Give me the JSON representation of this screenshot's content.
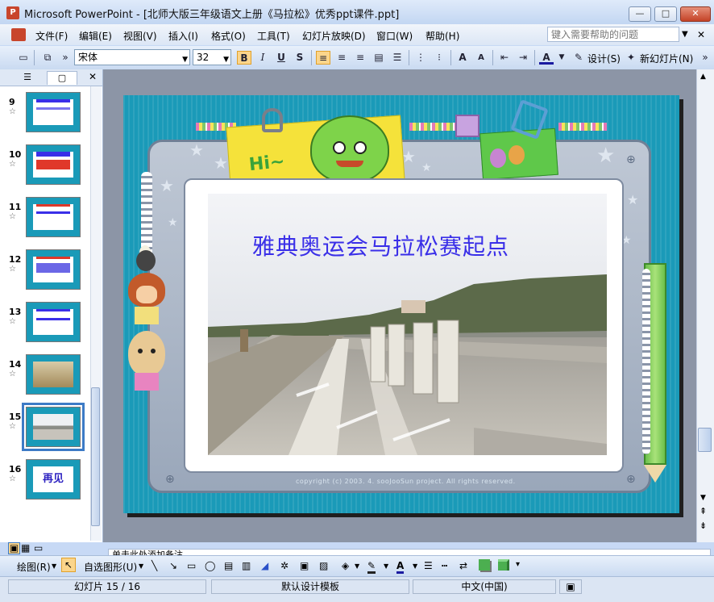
{
  "window": {
    "app_icon_letter": "P",
    "title": "Microsoft PowerPoint - [北师大版三年级语文上册《马拉松》优秀ppt课件.ppt]",
    "min": "—",
    "max": "□",
    "close": "✕"
  },
  "menu": {
    "items": [
      "文件(F)",
      "编辑(E)",
      "视图(V)",
      "插入(I)",
      "格式(O)",
      "工具(T)",
      "幻灯片放映(D)",
      "窗口(W)",
      "帮助(H)"
    ],
    "help_placeholder": "键入需要帮助的问题",
    "doc_close": "✕"
  },
  "format_toolbar": {
    "font_name": "宋体",
    "font_size": "32",
    "bold": "B",
    "italic": "I",
    "underline": "U",
    "shadow": "S",
    "design_label": "设计(S)",
    "new_slide_label": "新幻灯片(N)"
  },
  "left_pane": {
    "tab_outline_glyph": "☰",
    "tab_slides_glyph": "▢",
    "close_glyph": "✕",
    "slides": [
      {
        "num": "9"
      },
      {
        "num": "10"
      },
      {
        "num": "11"
      },
      {
        "num": "12"
      },
      {
        "num": "13"
      },
      {
        "num": "14"
      },
      {
        "num": "15"
      },
      {
        "num": "16",
        "text": "再见"
      }
    ],
    "star_glyph": "☆"
  },
  "slide": {
    "title": "雅典奥运会马拉松赛起点",
    "hi_text": "Hi~",
    "copyright": "copyright (c) 2003. 4. sooJooSun project. All rights reserved."
  },
  "notes": {
    "placeholder": "单击此处添加备注"
  },
  "draw_toolbar": {
    "draw_label": "绘图(R)",
    "autoshapes_label": "自选图形(U)"
  },
  "status": {
    "slide_pos": "幻灯片 15 / 16",
    "template": "默认设计模板",
    "language": "中文(中国)"
  },
  "colors": {
    "slide_bg": "#1a9ab8",
    "title_text": "#3a2fe8"
  }
}
